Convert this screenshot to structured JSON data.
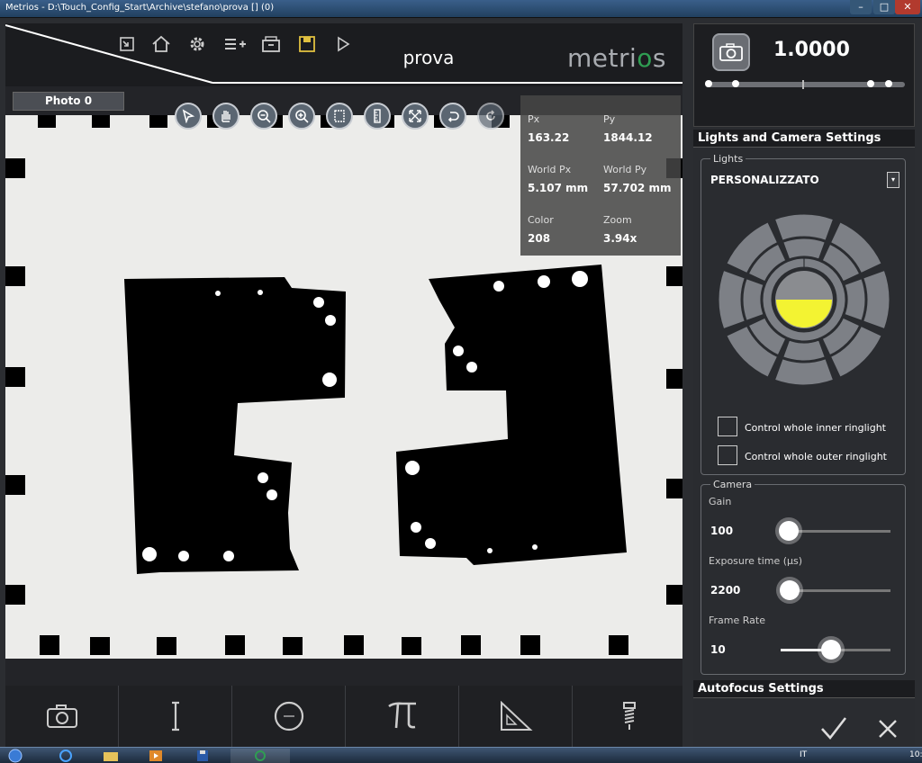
{
  "window": {
    "title": "Metrios - D:\\Touch_Config_Start\\Archive\\stefano\\prova [] (0)",
    "min": "–",
    "max": "□",
    "close": "✕"
  },
  "header": {
    "doc_title": "prova",
    "brand_pre": "metri",
    "brand_o": "o",
    "brand_post": "s",
    "toolbar_icons": [
      "import-icon",
      "home-icon",
      "gear-icon",
      "list-add-icon",
      "archive-icon",
      "save-icon",
      "play-icon"
    ]
  },
  "viewer": {
    "photo_tab": "Photo 0",
    "tools": [
      "pointer-icon",
      "pan-hand-icon",
      "zoom-out-icon",
      "zoom-in-icon",
      "frame-icon",
      "ruler-icon",
      "fit-icon",
      "undo-icon",
      "redo-icon"
    ],
    "info": {
      "px_label": "Px",
      "px_value": "163.22",
      "py_label": "Py",
      "py_value": "1844.12",
      "wpx_label": "World Px",
      "wpx_value": "5.107 mm",
      "wpy_label": "World Py",
      "wpy_value": "57.702 mm",
      "color_label": "Color",
      "color_value": "208",
      "zoom_label": "Zoom",
      "zoom_value": "3.94x"
    }
  },
  "bottom_tools": [
    "camera-icon",
    "line-icon",
    "circle-icon",
    "pi-icon",
    "triangle-ruler-icon",
    "screw-icon"
  ],
  "right": {
    "zoom_value": "1.0000",
    "lights_title": "Lights and Camera Settings",
    "lights_legend": "Lights",
    "lights_mode": "PERSONALIZZATO",
    "inner_ringlight": "Control whole inner ringlight",
    "outer_ringlight": "Control whole outer ringlight",
    "camera_legend": "Camera",
    "gain_label": "Gain",
    "gain_value": "100",
    "gain_level": 0.07,
    "exposure_label": "Exposure time (µs)",
    "exposure_value": "2200",
    "exposure_level": 0.08,
    "framerate_label": "Frame Rate",
    "framerate_value": "10",
    "framerate_level": 0.46,
    "autofocus_title": "Autofocus Settings"
  },
  "taskbar": {
    "lang": "IT",
    "clock": "10:"
  },
  "colors": {
    "accent_green": "#2f9d52",
    "light_on": "#f3f332",
    "panel": "#2a2c30"
  }
}
